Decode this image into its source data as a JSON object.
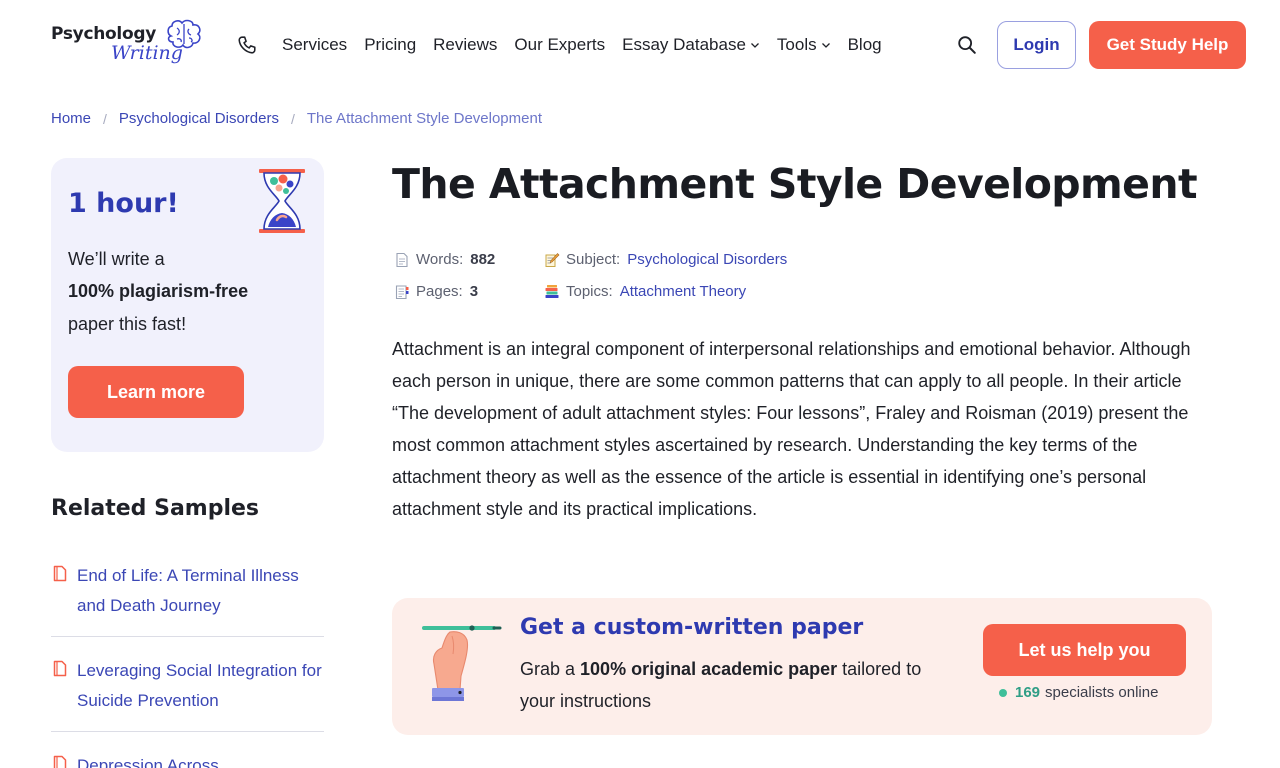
{
  "brand": {
    "logo_top": "Psychology",
    "logo_bottom": "Writing"
  },
  "nav": {
    "items": [
      {
        "label": "Services",
        "has_dropdown": false
      },
      {
        "label": "Pricing",
        "has_dropdown": false
      },
      {
        "label": "Reviews",
        "has_dropdown": false
      },
      {
        "label": "Our Experts",
        "has_dropdown": false
      },
      {
        "label": "Essay Database",
        "has_dropdown": true
      },
      {
        "label": "Tools",
        "has_dropdown": true
      },
      {
        "label": "Blog",
        "has_dropdown": false
      }
    ],
    "login_label": "Login",
    "study_help_label": "Get Study Help"
  },
  "breadcrumb": {
    "home": "Home",
    "category": "Psychological Disorders",
    "current": "The Attachment Style Development",
    "separator": "/"
  },
  "promo": {
    "title": "1 hour!",
    "line1": "We’ll write a",
    "line2": "100% plagiarism-free",
    "line3": "paper this fast!",
    "button_label": "Learn more"
  },
  "related": {
    "title": "Related Samples",
    "items": [
      "End of Life: A Terminal Illness and Death Journey",
      "Leveraging Social Integration for Suicide Prevention",
      "Depression Across"
    ]
  },
  "article": {
    "title": "The Attachment Style Development",
    "meta": {
      "words_label": "Words:",
      "words_value": "882",
      "pages_label": "Pages:",
      "pages_value": "3",
      "subject_label": "Subject:",
      "subject_value": "Psychological Disorders",
      "topics_label": "Topics:",
      "topics_value": "Attachment Theory"
    },
    "body": "Attachment is an integral component of interpersonal relationships and emotional behavior. Although each person in unique, there are some common patterns that can apply to all people. In their article “The development of adult attachment styles: Four lessons”, Fraley and Roisman (2019) present the most common attachment styles ascertained by research. Understanding the key terms of the attachment theory as well as the essence of the article is essential in identifying one’s personal attachment style and its practical implications."
  },
  "cta": {
    "title": "Get a custom-written paper",
    "desc_prefix": "Grab a ",
    "desc_bold": "100% original academic paper",
    "desc_suffix": " tailored to your instructions",
    "button_label": "Let us help you",
    "online_count": "169",
    "online_label": "specialists online"
  },
  "colors": {
    "accent": "#f5604a",
    "brand_blue": "#2e3ab0",
    "link": "#3b47b5",
    "promo_bg": "#f1f1fc",
    "cta_bg": "#fdeeea",
    "online_green": "#3fbf9a"
  }
}
